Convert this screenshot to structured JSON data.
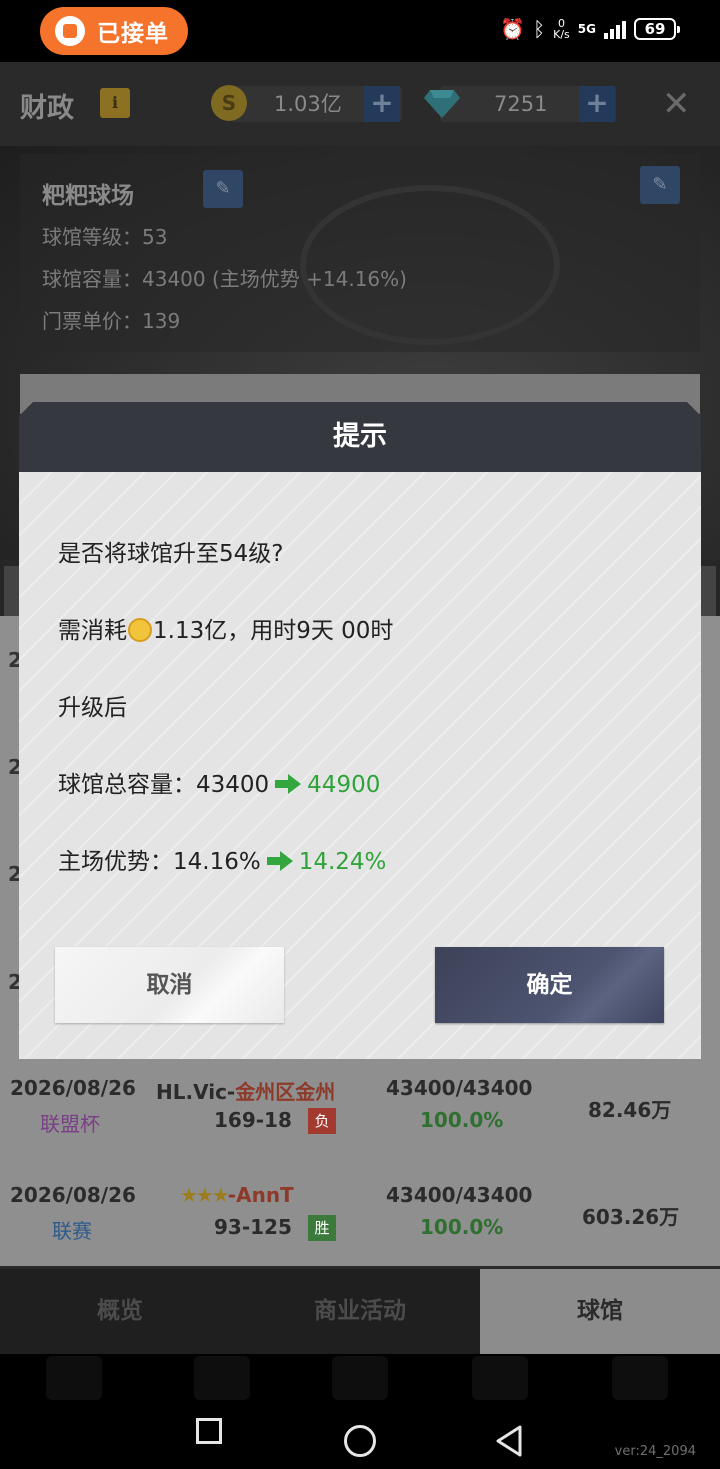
{
  "status_bar": {
    "order_label": "已接单",
    "net_speed_top": "0",
    "net_speed_bottom": "K/s",
    "network": "5G",
    "battery": "69"
  },
  "header": {
    "title": "财政",
    "info_icon": "info-icon",
    "coins": "1.03亿",
    "gems": "7251"
  },
  "venue": {
    "name": "粑粑球场",
    "level_label": "球馆等级：53",
    "capacity_label": "球馆容量：43400 (主场优势 +14.16%)",
    "ticket_label": "门票单价：139"
  },
  "dialog": {
    "title": "提示",
    "question": "是否将球馆升至54级?",
    "cost_prefix": "需消耗",
    "cost_suffix": "1.13亿，用时9天 00时",
    "after_label": "升级后",
    "capacity_label": "球馆总容量：",
    "capacity_from": "43400",
    "capacity_to": "44900",
    "advantage_label": "主场优势：",
    "advantage_from": "14.16%",
    "advantage_to": "14.24%",
    "cancel": "取消",
    "confirm": "确定"
  },
  "background_rows": {
    "peek_years": [
      "2",
      "2",
      "2",
      "2"
    ],
    "matches": [
      {
        "date": "2026/08/26",
        "type": "联盟杯",
        "type_color": "#7a3f86",
        "opponent_prefix": "HL.Vic-",
        "opponent_name": "金州区金州",
        "score": "169-18",
        "result": "负",
        "result_color": "#a23a30",
        "attendance": "43400/43400",
        "pct": "100.0%",
        "revenue": "82.46万"
      },
      {
        "date": "2026/08/26",
        "type": "联赛",
        "type_color": "#2f5b8a",
        "opponent_prefix": "",
        "opponent_name": "-AnnT",
        "score": "93-125",
        "result": "胜",
        "result_color": "#3c7a3c",
        "attendance": "43400/43400",
        "pct": "100.0%",
        "revenue": "603.26万"
      }
    ]
  },
  "bottom_tabs": [
    "概览",
    "商业活动",
    "球馆"
  ],
  "version": "ver:24_2094",
  "colors": {
    "accent_orange": "#f5732a",
    "dialog_header": "#36383f",
    "confirm_button": "#4d5470",
    "green_value": "#2fa33a"
  }
}
